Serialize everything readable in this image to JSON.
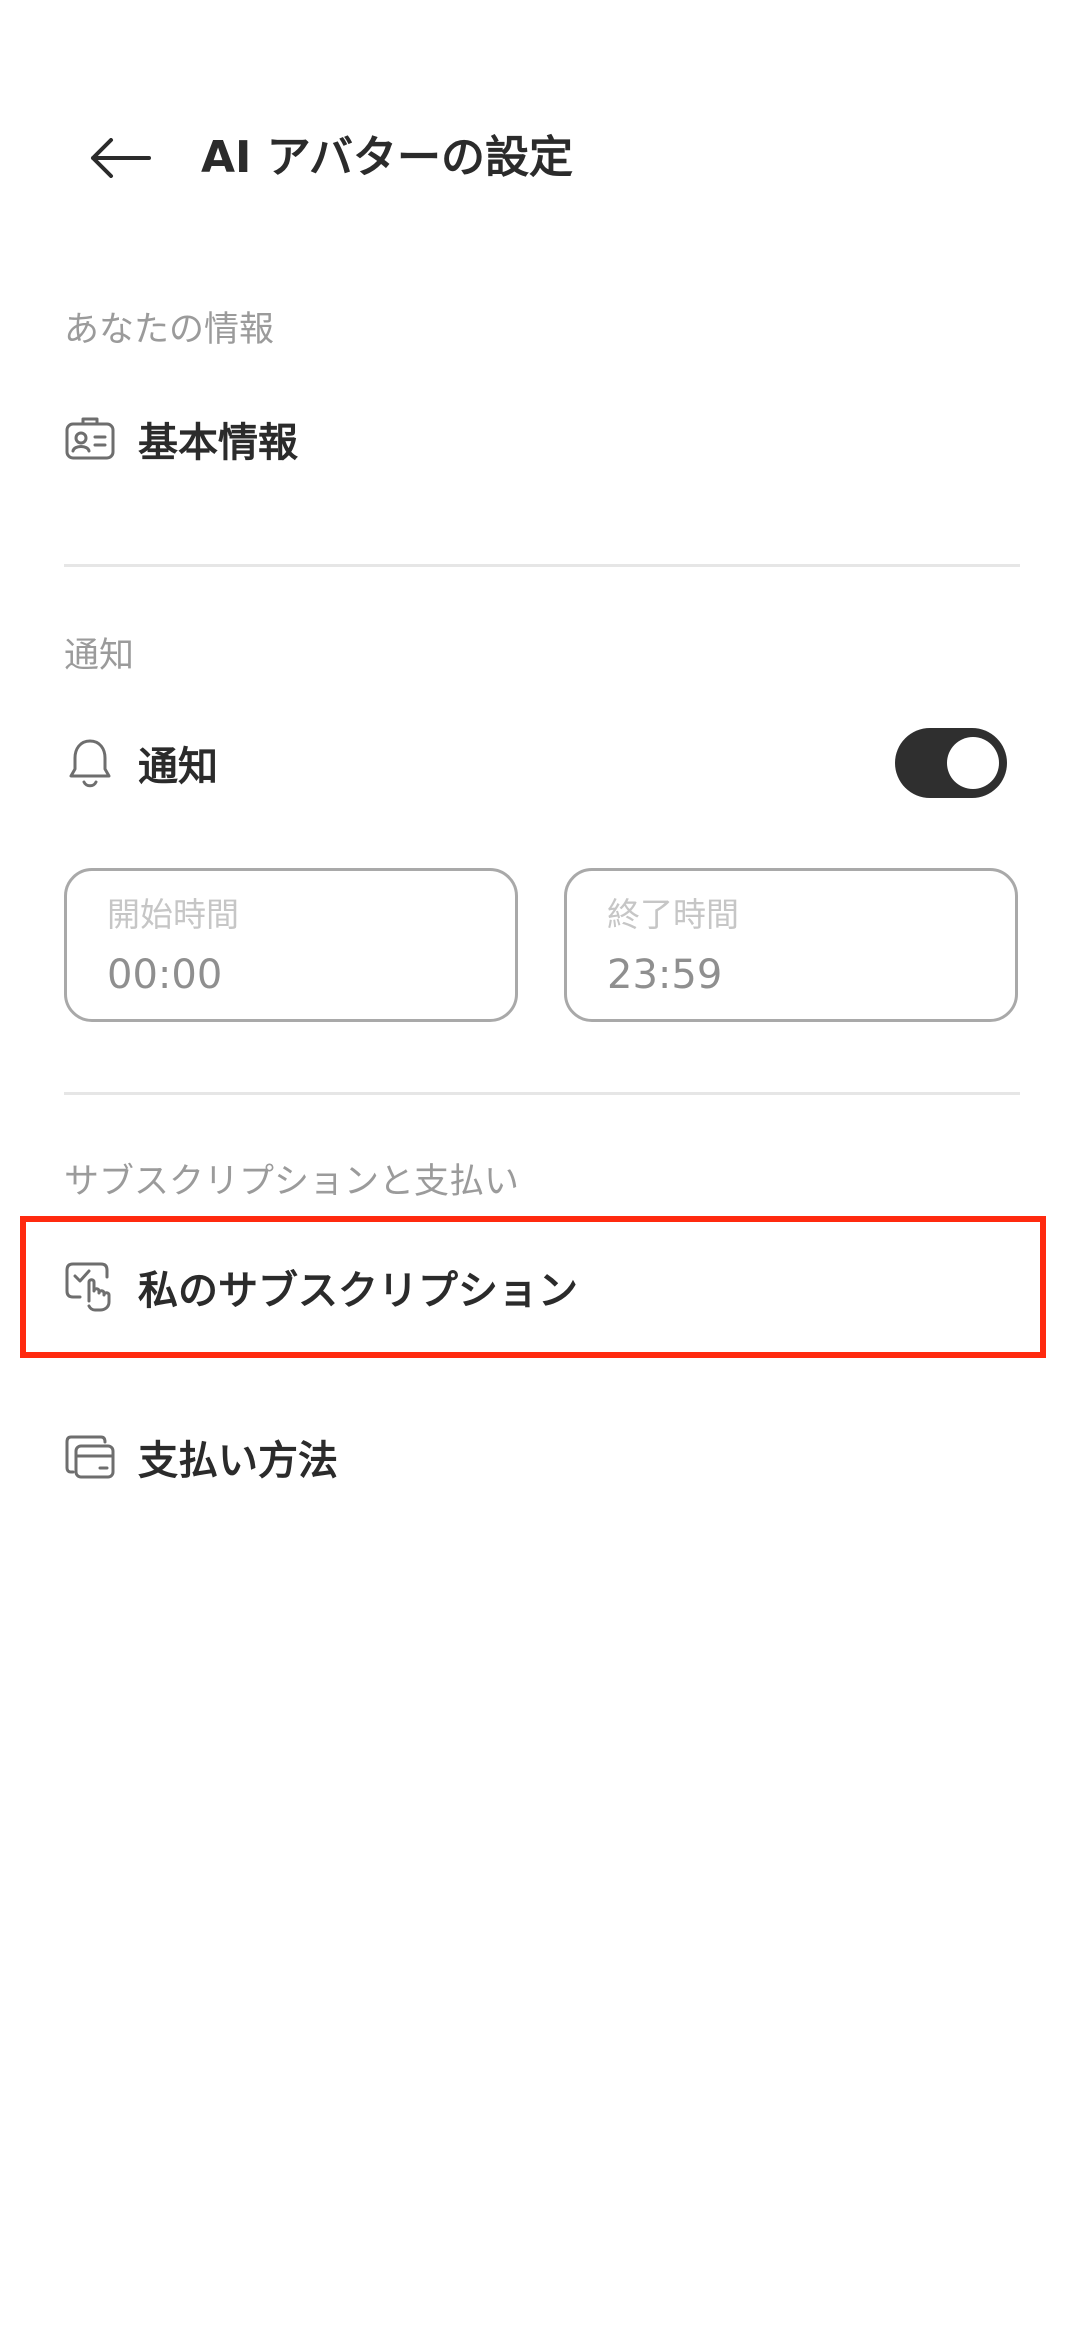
{
  "header": {
    "title": "AI アバターの設定",
    "back_icon": "arrow-left-icon"
  },
  "sections": {
    "info": {
      "header": "あなたの情報",
      "basic_info_label": "基本情報",
      "basic_info_icon": "id-card-icon"
    },
    "notifications": {
      "header": "通知",
      "label": "通知",
      "icon": "bell-icon",
      "toggle_on": true,
      "start": {
        "label": "開始時間",
        "value": "00:00"
      },
      "end": {
        "label": "終了時間",
        "value": "23:59"
      }
    },
    "subscription": {
      "header": "サブスクリプションと支払い",
      "my_subscription_label": "私のサブスクリプション",
      "my_subscription_icon": "touch-check-icon",
      "payment_method_label": "支払い方法",
      "payment_method_icon": "wallet-icon"
    }
  },
  "colors": {
    "text_primary": "#2b2b2b",
    "text_secondary": "#9b9b9b",
    "toggle_on": "#2f2f2f",
    "highlight": "#ff2a0f"
  }
}
